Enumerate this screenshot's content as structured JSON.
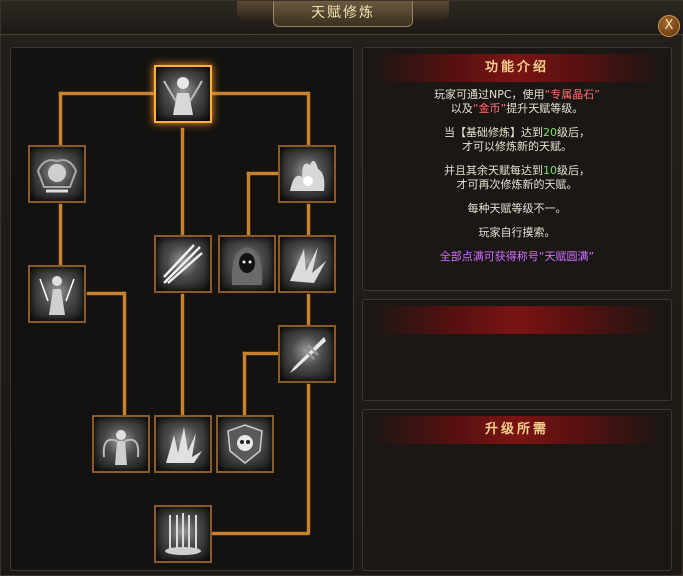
{
  "window": {
    "title": "天赋修炼",
    "close_label": "X"
  },
  "intro": {
    "header": "功能介绍",
    "p1_prefix": "玩家可通过NPC，使用",
    "p1_item": "“专属晶石”",
    "p1_mid": "以及",
    "p1_coin": "“金币”",
    "p1_suffix": "提升天赋等级。",
    "p2_prefix": "当【基础修炼】达到",
    "p2_level": "20",
    "p2_suffix": "级后，",
    "p2_line2": "才可以修炼新的天赋。",
    "p3_prefix": "并且其余天赋每达到",
    "p3_level": "10",
    "p3_suffix": "级后，",
    "p3_line2": "才可再次修炼新的天赋。",
    "p4": "每种天赋等级不一。",
    "p5": "玩家自行摸索。",
    "p6": "全部点满可获得称号“天赋圆满”"
  },
  "upgrade": {
    "header": "升级所需"
  },
  "skills": [
    {
      "name": "root-skill",
      "icon": "figure-icon",
      "active": true
    },
    {
      "name": "skill-left-1",
      "icon": "winged-idol-icon"
    },
    {
      "name": "skill-right-1",
      "icon": "flame-burst-icon"
    },
    {
      "name": "skill-left-2",
      "icon": "figure-strike-icon"
    },
    {
      "name": "skill-mid-1",
      "icon": "light-blades-icon"
    },
    {
      "name": "skill-mid-2",
      "icon": "shadow-hood-icon"
    },
    {
      "name": "skill-right-2",
      "icon": "feather-burst-icon"
    },
    {
      "name": "skill-right-3",
      "icon": "drill-strike-icon"
    },
    {
      "name": "skill-bottom-1",
      "icon": "winged-figure-icon"
    },
    {
      "name": "skill-bottom-2",
      "icon": "spike-burst-icon"
    },
    {
      "name": "skill-bottom-3",
      "icon": "skull-shield-icon"
    },
    {
      "name": "skill-final",
      "icon": "pillar-storm-icon"
    }
  ]
}
